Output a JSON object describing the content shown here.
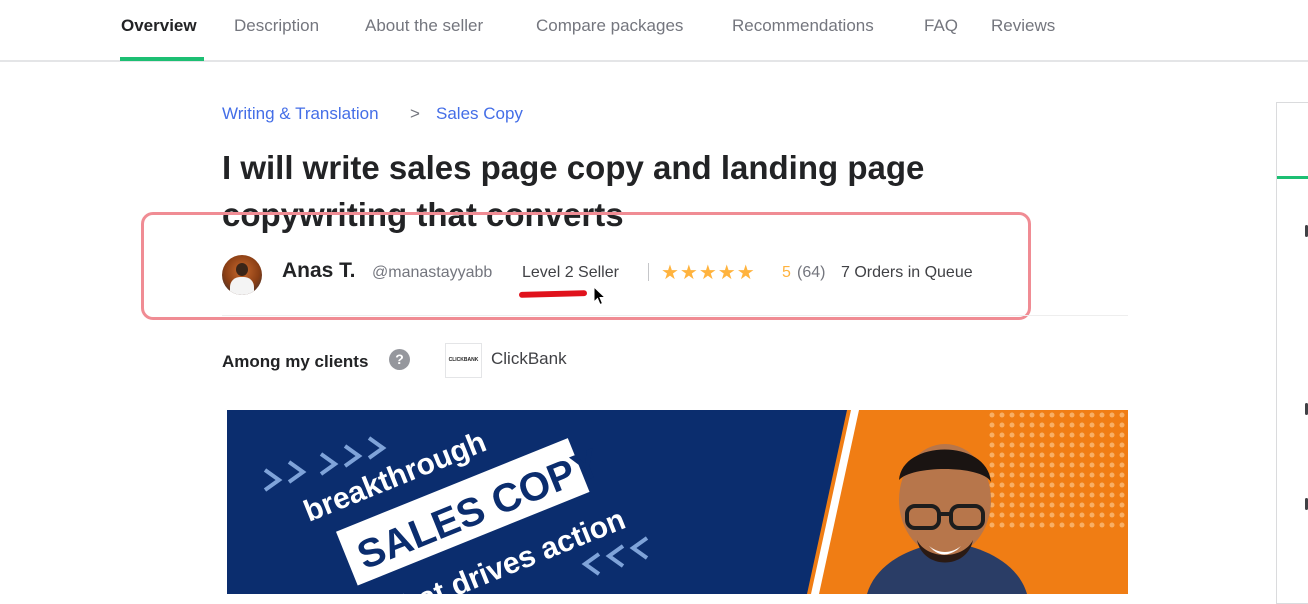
{
  "nav": {
    "tabs": [
      {
        "label": "Overview",
        "active": true
      },
      {
        "label": "Description"
      },
      {
        "label": "About the seller"
      },
      {
        "label": "Compare packages"
      },
      {
        "label": "Recommendations"
      },
      {
        "label": "FAQ"
      },
      {
        "label": "Reviews"
      }
    ]
  },
  "breadcrumb": {
    "category": "Writing & Translation",
    "separator": ">",
    "subcategory": "Sales Copy"
  },
  "gig": {
    "title": "I will write sales page copy and landing page copywriting that converts"
  },
  "seller": {
    "name": "Anas T.",
    "handle": "@manastayyabb",
    "level": "Level 2 Seller",
    "stars": "★★★★★",
    "rating": "5",
    "reviews": "(64)",
    "queue": "7 Orders in Queue"
  },
  "clients": {
    "label": "Among my clients",
    "help_icon": "?",
    "logo_text": "CLICKBANK",
    "name": "ClickBank"
  },
  "gig_image": {
    "line1": "breakthrough",
    "line2": "SALES COPY",
    "line3": "that drives action"
  },
  "colors": {
    "accent": "#1dbf73",
    "link": "#446ee7",
    "star": "#ffb33e",
    "highlight": "#f08c94",
    "banner_blue": "#0b2d6e",
    "banner_orange": "#f07d14"
  }
}
